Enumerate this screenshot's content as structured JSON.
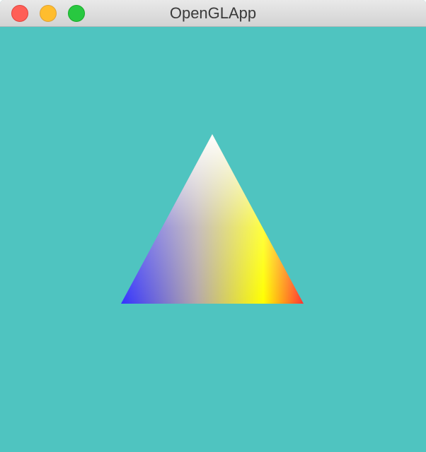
{
  "window": {
    "title": "OpenGLApp",
    "buttons": {
      "close_color": "#ff5f57",
      "minimize_color": "#ffbd2e",
      "zoom_color": "#28c840"
    }
  },
  "canvas": {
    "clear_color": "#4fc4c0",
    "triangle": {
      "top_color": "#ffffff",
      "left_color": "#3333ff",
      "right_color": "#ff3333",
      "bottom_mid_color": "#ffff00"
    }
  }
}
